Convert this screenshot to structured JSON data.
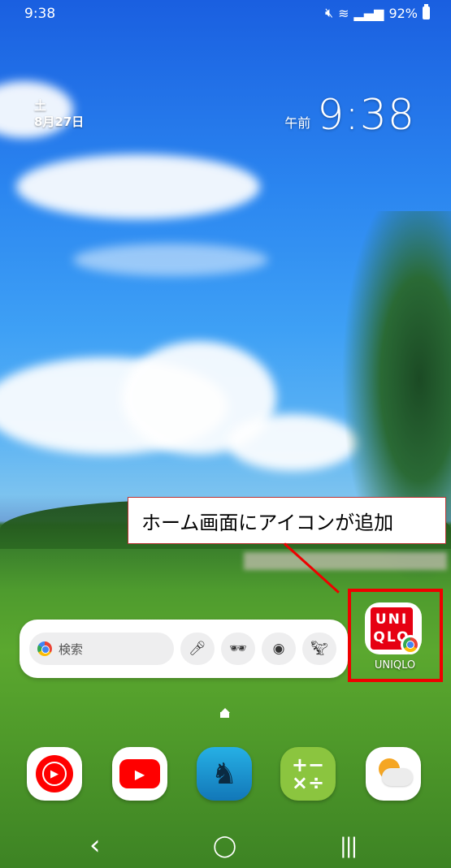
{
  "status_bar": {
    "time": "9:38",
    "battery": "92%",
    "icons": [
      "mute-icon",
      "wifi-icon",
      "signal-icon",
      "battery-icon"
    ]
  },
  "lock_date": {
    "day": "土",
    "date": "8月27日"
  },
  "lock_clock": {
    "ampm": "午前",
    "time": "9:38"
  },
  "callout": {
    "text": "ホーム画面にアイコンが追加"
  },
  "search_widget": {
    "placeholder": "検索",
    "buttons": [
      "mic-icon",
      "incognito-icon",
      "lens-icon",
      "dino-icon"
    ]
  },
  "uniqlo_app": {
    "logo_top": "UNI",
    "logo_bottom": "QLO",
    "label": "UNIQLO"
  },
  "dock": [
    "youtube-music-icon",
    "youtube-icon",
    "kindle-icon",
    "calculator-icon",
    "weather-icon"
  ],
  "nav_bar": {
    "back": "‹",
    "home": "◯",
    "recents": "|||"
  },
  "colors": {
    "highlight": "#ee0000",
    "uniqlo_red": "#e60012"
  }
}
